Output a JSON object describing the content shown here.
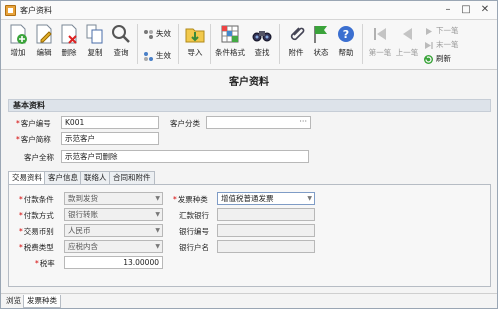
{
  "window": {
    "title": "客户资料"
  },
  "toolbar": {
    "add": "增加",
    "edit": "编辑",
    "delete": "删除",
    "copy": "复制",
    "query": "查询",
    "invalidate": "失效",
    "activate": "生效",
    "import": "导入",
    "grid_format": "条件格式",
    "find": "查找",
    "attachment": "附件",
    "status": "状态",
    "help": "帮助",
    "first": "第一笔",
    "prev": "上一笔",
    "next": "下一笔",
    "last": "末一笔",
    "refresh": "刷新"
  },
  "page": {
    "title": "客户资料"
  },
  "basic": {
    "section_title": "基本资料",
    "code_label": "客户编号",
    "code_value": "K001",
    "category_label": "客户分类",
    "category_value": "",
    "short_name_label": "客户简称",
    "short_name_value": "示范客户",
    "full_name_label": "客户全称",
    "full_name_value": "示范客户司删除"
  },
  "tabs": [
    "交易资料",
    "客户信息",
    "联络人",
    "合同和附件"
  ],
  "trade": {
    "payment_terms_label": "付款条件",
    "payment_terms_value": "款到发货",
    "payment_method_label": "付款方式",
    "payment_method_value": "银行转账",
    "currency_label": "交易币别",
    "currency_value": "人民币",
    "tax_type_label": "税费类型",
    "tax_type_value": "应税内含",
    "tax_rate_label": "税率",
    "tax_rate_value": "13.00000",
    "invoice_type_label": "发票种类",
    "invoice_type_value": "增值税普通发票",
    "remit_bank_label": "汇款银行",
    "remit_bank_value": "",
    "bank_code_label": "银行编号",
    "bank_code_value": "",
    "bank_account_label": "银行户名",
    "bank_account_value": ""
  },
  "bottom_tabs": [
    "浏览",
    "发票种类"
  ]
}
